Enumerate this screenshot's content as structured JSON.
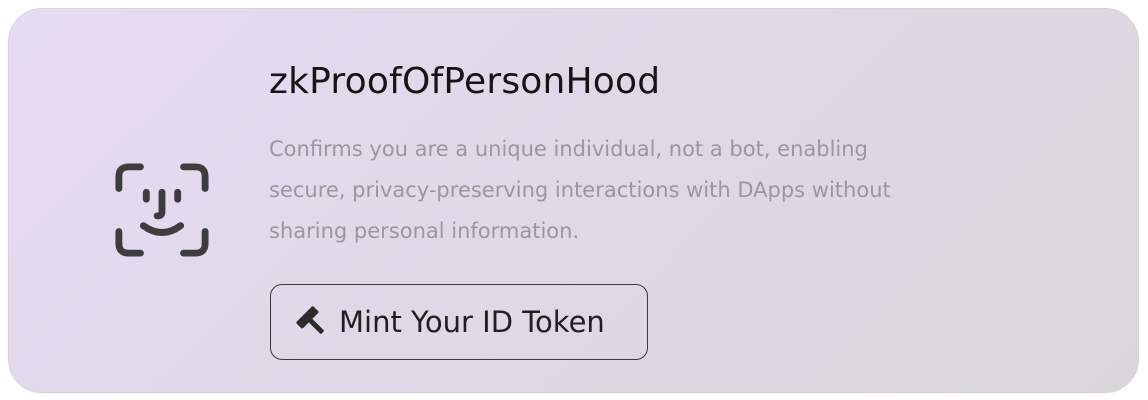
{
  "card": {
    "title": "zkProofOfPersonHood",
    "description": "Confirms you are a unique individual, not a bot, enabling secure, privacy-preserving interactions with DApps without sharing personal information.",
    "icon": "face-id-icon",
    "gradient": [
      "#e7dbf6",
      "#e0d8e7",
      "#d9d6da"
    ]
  },
  "button": {
    "label": "Mint Your ID Token",
    "icon": "hammer-icon"
  }
}
